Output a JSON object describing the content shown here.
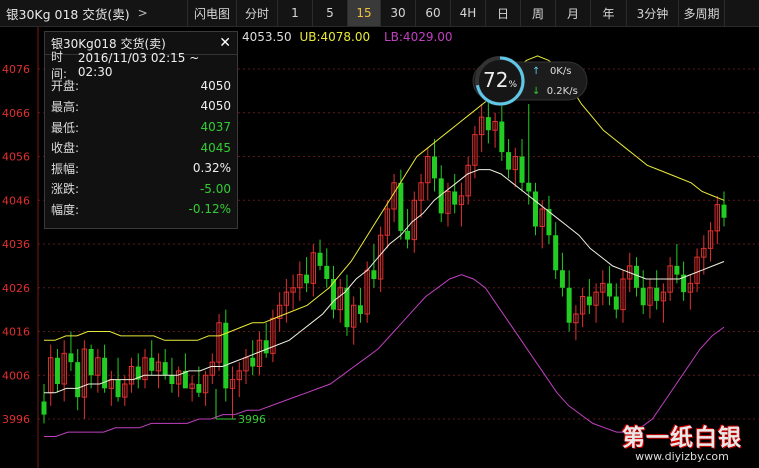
{
  "header": {
    "title": "银30Kg 018 交货(卖)",
    "expand_arrow": ">"
  },
  "tabs": [
    {
      "label": "闪电图"
    },
    {
      "label": "分时"
    },
    {
      "label": "1"
    },
    {
      "label": "5"
    },
    {
      "label": "15",
      "active": true
    },
    {
      "label": "30"
    },
    {
      "label": "60"
    },
    {
      "label": "4H"
    },
    {
      "label": "日"
    },
    {
      "label": "周"
    },
    {
      "label": "月"
    },
    {
      "label": "年"
    },
    {
      "label": "3分钟"
    },
    {
      "label": "多周期"
    }
  ],
  "tooltip": {
    "title": "银30Kg018 交货(卖)",
    "close_symbol": "✕",
    "time_label": "时间:",
    "time_value": "2016/11/03 02:15 ~ 02:30",
    "open_label": "开盘:",
    "open_value": "4050",
    "high_label": "最高:",
    "high_value": "4050",
    "low_label": "最低:",
    "low_value": "4037",
    "close_label": "收盘:",
    "close_value": "4045",
    "amp_label": "振幅:",
    "amp_value": "0.32%",
    "chg_label": "涨跌:",
    "chg_value": "-5.00",
    "pct_label": "幅度:",
    "pct_value": "-0.12%"
  },
  "main_indicator": {
    "mid": "4053.50",
    "ub": "UB:4078.00",
    "lb": "LB:4029.00"
  },
  "gauge": {
    "percent": "72",
    "percent_unit": "%",
    "up_speed": "0K/s",
    "down_speed": "0.2K/s"
  },
  "watermark": {
    "name": "第一纸白银",
    "url": "www.diyizby.com"
  },
  "colors": {
    "up": "#e03030",
    "down": "#22cc22",
    "ub": "#eaea3a",
    "mid": "#f0f0e0",
    "lb": "#c040c0",
    "grid": "#5a1a1a"
  },
  "chart_data": {
    "type": "candlestick",
    "y_ticks": [
      "4076",
      "4066",
      "4056",
      "4046",
      "4036",
      "4026",
      "4016",
      "4006",
      "3996"
    ],
    "ylim": [
      3991,
      4081
    ],
    "min_label": "3996",
    "candles": [
      [
        4000,
        4004,
        3995,
        3997
      ],
      [
        4002,
        4013,
        3999,
        4010
      ],
      [
        4010,
        4012,
        4002,
        4004
      ],
      [
        4004,
        4014,
        4000,
        4011
      ],
      [
        4011,
        4016,
        4007,
        4009
      ],
      [
        4009,
        4012,
        3998,
        4001
      ],
      [
        4001,
        4014,
        3996,
        4012
      ],
      [
        4012,
        4013,
        4003,
        4006
      ],
      [
        4006,
        4012,
        4002,
        4010
      ],
      [
        4010,
        4013,
        4002,
        4003
      ],
      [
        4003,
        4007,
        3999,
        4005
      ],
      [
        4005,
        4010,
        4000,
        4001
      ],
      [
        4001,
        4006,
        3999,
        4004
      ],
      [
        4004,
        4010,
        4002,
        4008
      ],
      [
        4008,
        4011,
        4003,
        4005
      ],
      [
        4005,
        4012,
        4003,
        4010
      ],
      [
        4010,
        4014,
        4006,
        4007
      ],
      [
        4007,
        4011,
        4003,
        4009
      ],
      [
        4009,
        4012,
        4005,
        4006
      ],
      [
        4006,
        4010,
        4002,
        4004
      ],
      [
        4004,
        4008,
        4001,
        4007
      ],
      [
        4007,
        4011,
        4004,
        4003
      ],
      [
        4003,
        4006,
        4000,
        4004
      ],
      [
        4004,
        4008,
        4001,
        4002
      ],
      [
        4002,
        4007,
        3999,
        4006
      ],
      [
        4006,
        4011,
        4004,
        4009
      ],
      [
        4009,
        4020,
        4007,
        4018
      ],
      [
        4018,
        4021,
        4000,
        4003
      ],
      [
        4003,
        4008,
        3996,
        4005
      ],
      [
        4005,
        4009,
        4001,
        4007
      ],
      [
        4007,
        4012,
        4004,
        4010
      ],
      [
        4010,
        4014,
        4006,
        4008
      ],
      [
        4008,
        4016,
        4006,
        4014
      ],
      [
        4014,
        4018,
        4010,
        4011
      ],
      [
        4011,
        4021,
        4009,
        4019
      ],
      [
        4019,
        4025,
        4016,
        4022
      ],
      [
        4022,
        4028,
        4018,
        4025
      ],
      [
        4025,
        4029,
        4021,
        4026
      ],
      [
        4026,
        4032,
        4023,
        4029
      ],
      [
        4029,
        4033,
        4025,
        4027
      ],
      [
        4027,
        4036,
        4024,
        4034
      ],
      [
        4034,
        4037,
        4030,
        4031
      ],
      [
        4031,
        4035,
        4026,
        4028
      ],
      [
        4028,
        4031,
        4019,
        4021
      ],
      [
        4021,
        4028,
        4018,
        4026
      ],
      [
        4026,
        4029,
        4015,
        4017
      ],
      [
        4017,
        4024,
        4013,
        4022
      ],
      [
        4022,
        4026,
        4018,
        4020
      ],
      [
        4020,
        4032,
        4018,
        4030
      ],
      [
        4030,
        4036,
        4026,
        4028
      ],
      [
        4028,
        4040,
        4025,
        4038
      ],
      [
        4038,
        4046,
        4035,
        4044
      ],
      [
        4044,
        4052,
        4041,
        4050
      ],
      [
        4050,
        4053,
        4037,
        4039
      ],
      [
        4039,
        4044,
        4035,
        4037
      ],
      [
        4037,
        4048,
        4034,
        4046
      ],
      [
        4046,
        4052,
        4042,
        4050
      ],
      [
        4050,
        4058,
        4046,
        4056
      ],
      [
        4056,
        4060,
        4048,
        4051
      ],
      [
        4051,
        4054,
        4041,
        4043
      ],
      [
        4043,
        4050,
        4040,
        4048
      ],
      [
        4048,
        4052,
        4043,
        4045
      ],
      [
        4045,
        4050,
        4040,
        4047
      ],
      [
        4047,
        4056,
        4045,
        4054
      ],
      [
        4054,
        4063,
        4051,
        4061
      ],
      [
        4061,
        4068,
        4057,
        4065
      ],
      [
        4065,
        4069,
        4059,
        4062
      ],
      [
        4062,
        4066,
        4058,
        4064
      ],
      [
        4064,
        4068,
        4055,
        4057
      ],
      [
        4057,
        4060,
        4051,
        4053
      ],
      [
        4053,
        4058,
        4049,
        4056
      ],
      [
        4056,
        4060,
        4048,
        4050
      ],
      [
        4050,
        4068,
        4045,
        4048
      ],
      [
        4048,
        4050,
        4038,
        4040
      ],
      [
        4040,
        4046,
        4035,
        4044
      ],
      [
        4044,
        4047,
        4036,
        4038
      ],
      [
        4038,
        4041,
        4028,
        4030
      ],
      [
        4030,
        4034,
        4024,
        4026
      ],
      [
        4026,
        4030,
        4016,
        4018
      ],
      [
        4018,
        4022,
        4014,
        4020
      ],
      [
        4020,
        4026,
        4017,
        4024
      ],
      [
        4024,
        4028,
        4020,
        4022
      ],
      [
        4022,
        4027,
        4018,
        4025
      ],
      [
        4025,
        4030,
        4022,
        4027
      ],
      [
        4027,
        4031,
        4022,
        4024
      ],
      [
        4024,
        4027,
        4019,
        4021
      ],
      [
        4021,
        4030,
        4018,
        4028
      ],
      [
        4028,
        4034,
        4025,
        4031
      ],
      [
        4031,
        4033,
        4024,
        4026
      ],
      [
        4026,
        4030,
        4020,
        4022
      ],
      [
        4022,
        4028,
        4019,
        4026
      ],
      [
        4026,
        4030,
        4021,
        4023
      ],
      [
        4023,
        4027,
        4018,
        4025
      ],
      [
        4025,
        4033,
        4023,
        4031
      ],
      [
        4031,
        4036,
        4027,
        4029
      ],
      [
        4029,
        4032,
        4023,
        4025
      ],
      [
        4025,
        4029,
        4021,
        4027
      ],
      [
        4027,
        4035,
        4025,
        4033
      ],
      [
        4033,
        4038,
        4029,
        4035
      ],
      [
        4035,
        4041,
        4032,
        4039
      ],
      [
        4039,
        4047,
        4036,
        4045
      ],
      [
        4045,
        4048,
        4040,
        4042
      ]
    ],
    "ub_line": [
      4014,
      4014,
      4015,
      4015,
      4016,
      4016,
      4016,
      4015,
      4015,
      4015,
      4015,
      4014,
      4014,
      4014,
      4014,
      4015,
      4015,
      4016,
      4017,
      4018,
      4018,
      4019,
      4020,
      4021,
      4022,
      4024,
      4026,
      4029,
      4032,
      4036,
      4040,
      4044,
      4048,
      4052,
      4056,
      4058,
      4060,
      4062,
      4064,
      4066,
      4068,
      4070,
      4073,
      4076,
      4078,
      4079,
      4078,
      4076,
      4072,
      4068,
      4065,
      4062,
      4060,
      4058,
      4056,
      4054,
      4053,
      4052,
      4051,
      4050,
      4048,
      4047,
      4046
    ],
    "mid_line": [
      4002,
      4002,
      4003,
      4003,
      4004,
      4004,
      4005,
      4005,
      4005,
      4006,
      4006,
      4006,
      4006,
      4007,
      4007,
      4008,
      4008,
      4009,
      4010,
      4011,
      4012,
      4013,
      4014,
      4016,
      4018,
      4020,
      4023,
      4025,
      4028,
      4030,
      4033,
      4036,
      4038,
      4041,
      4043,
      4046,
      4048,
      4050,
      4052,
      4053,
      4053,
      4052,
      4050,
      4048,
      4046,
      4044,
      4042,
      4040,
      4038,
      4035,
      4033,
      4031,
      4030,
      4029,
      4028,
      4028,
      4028,
      4028,
      4029,
      4030,
      4031,
      4032
    ],
    "lb_line": [
      3992,
      3992,
      3993,
      3993,
      3993,
      3993,
      3994,
      3994,
      3994,
      3995,
      3995,
      3995,
      3995,
      3996,
      3996,
      3997,
      3997,
      3998,
      3998,
      3999,
      4000,
      4001,
      4002,
      4003,
      4004,
      4006,
      4008,
      4010,
      4012,
      4015,
      4018,
      4021,
      4024,
      4026,
      4028,
      4029,
      4028,
      4026,
      4022,
      4018,
      4014,
      4010,
      4006,
      4002,
      3999,
      3997,
      3995,
      3994,
      3993,
      3993,
      3994,
      3996,
      4000,
      4004,
      4008,
      4012,
      4015,
      4017
    ]
  }
}
